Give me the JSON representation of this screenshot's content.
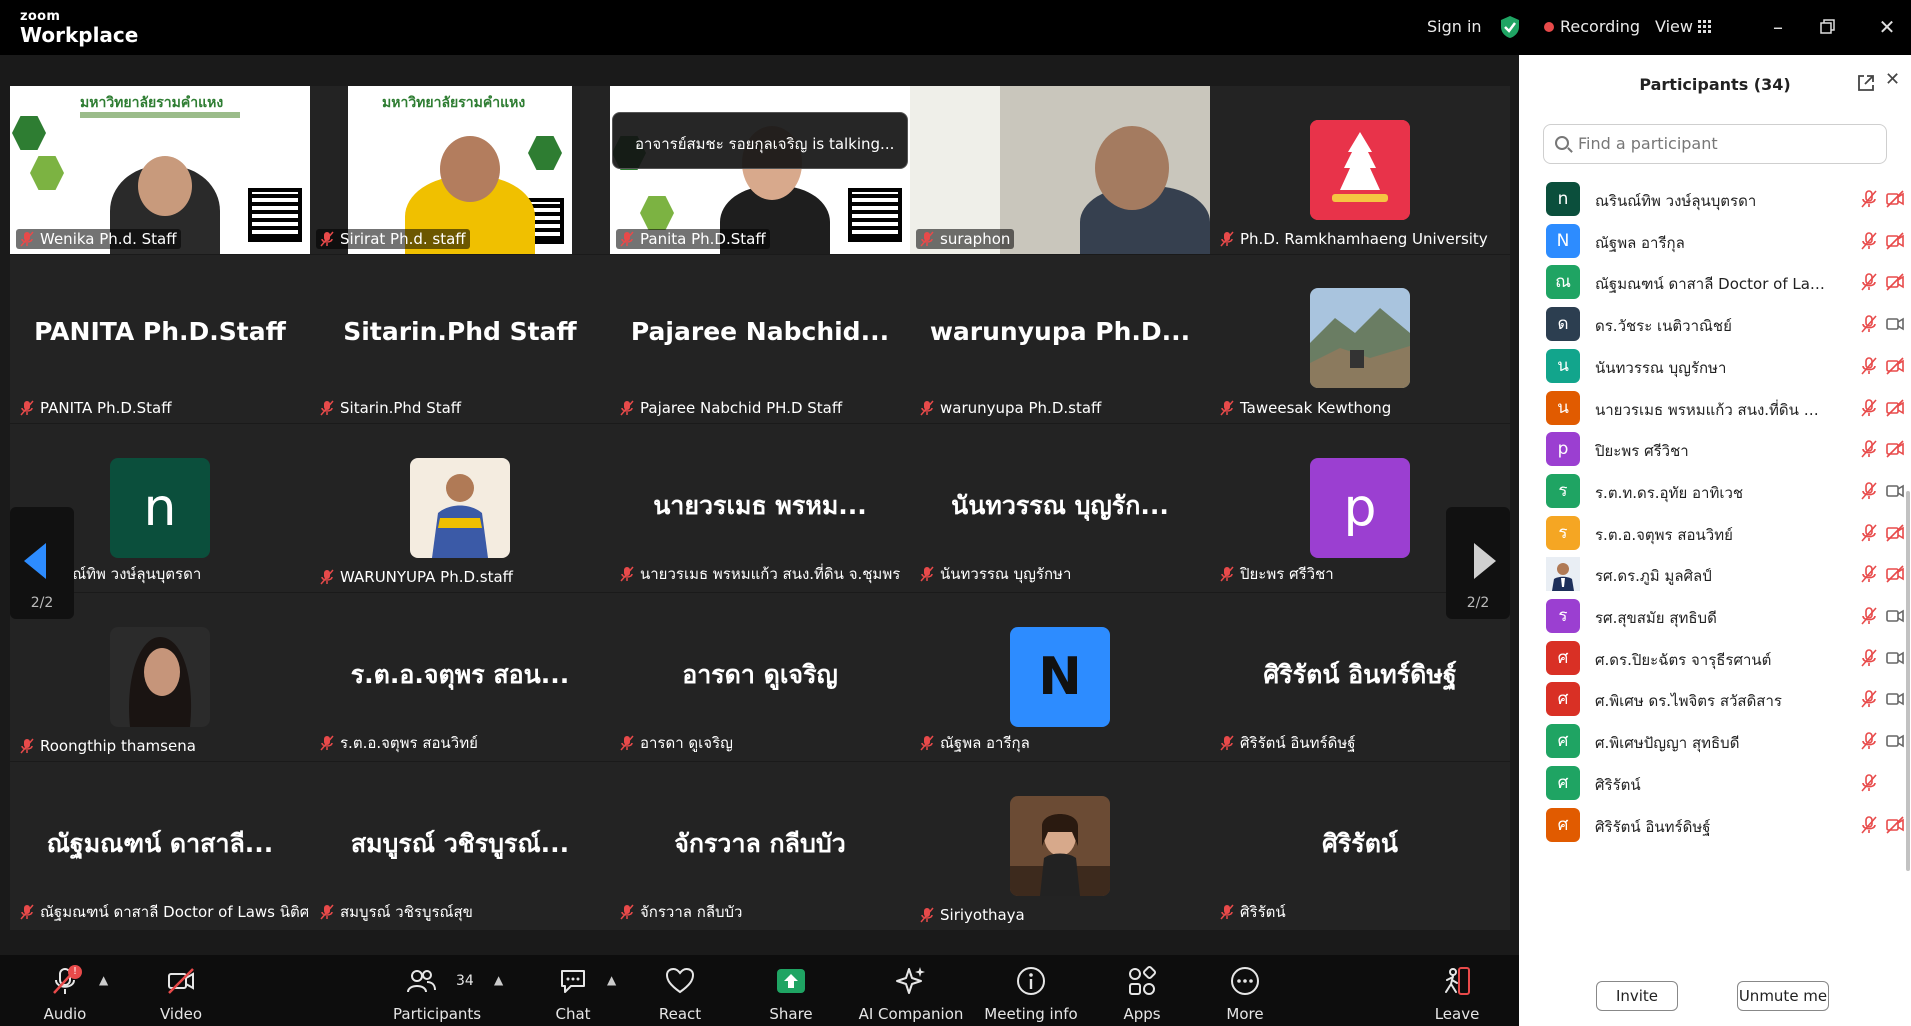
{
  "app": {
    "brand_small": "zoom",
    "brand_big": "Workplace"
  },
  "topbar": {
    "sign_in": "Sign in",
    "recording": "Recording",
    "view": "View"
  },
  "talking_banner": "อาจารย์สมชะ  รอยกุลเจริญ is talking...",
  "pager": {
    "left": "2/2",
    "right": "2/2"
  },
  "tiles": [
    {
      "name": "Wenika Ph.d. Staff",
      "big": ""
    },
    {
      "name": "Sirirat Ph.d. staff",
      "big": ""
    },
    {
      "name": "Panita Ph.D.Staff",
      "big": ""
    },
    {
      "name": "suraphon",
      "big": ""
    },
    {
      "name": "Ph.D. Ramkhamhaeng University",
      "big": ""
    },
    {
      "name": "PANITA Ph.D.Staff",
      "big": "PANITA Ph.D.Staff"
    },
    {
      "name": "Sitarin.Phd Staff",
      "big": "Sitarin.Phd Staff"
    },
    {
      "name": "Pajaree Nabchid PH.D Staff",
      "big": "Pajaree  Nabchid..."
    },
    {
      "name": "warunyupa Ph.D.staff",
      "big": "warunyupa  Ph.D..."
    },
    {
      "name": "Taweesak Kewthong",
      "big": ""
    },
    {
      "name": "ณรินณ์ทิพ วงษ์ลุนบุตรดา",
      "big": "",
      "avatar": "n"
    },
    {
      "name": "WARUNYUPA Ph.D.staff",
      "big": ""
    },
    {
      "name": "นายวรเมธ  พรหมแก้ว  สนง.ที่ดิน จ.ชุมพร",
      "big": "นายวรเมธ  พรหม..."
    },
    {
      "name": "นันทวรรณ บุญรักษา",
      "big": "นันทวรรณ บุญรัก..."
    },
    {
      "name": "ปิยะพร ศรีวิชา",
      "big": "",
      "avatar": "p"
    },
    {
      "name": "Roongthip thamsena",
      "big": ""
    },
    {
      "name": "ร.ต.อ.จตุพร  สอนวิทย์",
      "big": "ร.ต.อ.จตุพร  สอน..."
    },
    {
      "name": "อารดา ดูเจริญ",
      "big": "อารดา ดูเจริญ"
    },
    {
      "name": "ณัฐพล อารีกุล",
      "big": "",
      "avatar": "N"
    },
    {
      "name": "ศิริรัตน์ อินทร์ดิษฐ์",
      "big": "ศิริรัตน์ อินทร์ดิษฐ์"
    },
    {
      "name": "ณัฐมณฑน์ ดาสาลี Doctor of Laws นิติศา...",
      "big": "ณัฐมณฑน์ ดาสาลี..."
    },
    {
      "name": "สมบูรณ์ วชิรบูรณ์สุข",
      "big": "สมบูรณ์ วชิรบูรณ์..."
    },
    {
      "name": "จักรวาล กลีบบัว",
      "big": "จักรวาล กลีบบัว"
    },
    {
      "name": "Siriyothaya",
      "big": ""
    },
    {
      "name": "ศิริรัตน์",
      "big": "ศิริรัตน์"
    }
  ],
  "toolbar": {
    "audio": "Audio",
    "video": "Video",
    "participants": "Participants",
    "participants_count": "34",
    "chat": "Chat",
    "react": "React",
    "share": "Share",
    "ai_companion": "AI Companion",
    "meeting_info": "Meeting info",
    "apps": "Apps",
    "more": "More",
    "leave": "Leave",
    "audio_badge": "!"
  },
  "panel": {
    "title": "Participants (34)",
    "search_placeholder": "Find a participant",
    "invite": "Invite",
    "unmute_me": "Unmute me",
    "participants": [
      {
        "initial": "n",
        "color": "#0b4f3c",
        "name": "ณรินณ์ทิพ วงษ์ลุนบุตรดา",
        "video": "off"
      },
      {
        "initial": "N",
        "color": "#2d8cff",
        "name": "ณัฐพล อารีกุล",
        "video": "off"
      },
      {
        "initial": "ณ",
        "color": "#1fa463",
        "name": "ณัฐมณฑน์ ดาสาลี Doctor of Laws ...",
        "video": "off"
      },
      {
        "initial": "ด",
        "color": "#2c3e50",
        "name": "ดร.วัชระ เนติวาณิชย์",
        "video": "on"
      },
      {
        "initial": "น",
        "color": "#12a58c",
        "name": "นันทวรรณ บุญรักษา",
        "video": "off"
      },
      {
        "initial": "น",
        "color": "#e15b00",
        "name": "นายวรเมธ  พรหมแก้ว  สนง.ที่ดิน จ.ชุม...",
        "video": "off"
      },
      {
        "initial": "p",
        "color": "#9b3fd1",
        "name": "ปิยะพร ศรีวิชา",
        "video": "off"
      },
      {
        "initial": "ร",
        "color": "#1fa463",
        "name": "ร.ต.ท.ดร.อุทัย อาทิเวช",
        "video": "on"
      },
      {
        "initial": "ร",
        "color": "#f5a623",
        "name": "ร.ต.อ.จตุพร  สอนวิทย์",
        "video": "off"
      },
      {
        "initial": "",
        "color": "#dddddd",
        "name": "รศ.ดร.ภูมิ มูลศิลป์",
        "video": "off",
        "photo": true
      },
      {
        "initial": "ร",
        "color": "#9b3fd1",
        "name": "รศ.สุขสมัย  สุทธิบดี",
        "video": "on"
      },
      {
        "initial": "ศ",
        "color": "#d93025",
        "name": "ศ.ดร.ปิยะฉัตร จารุธีรศานต์",
        "video": "on"
      },
      {
        "initial": "ศ",
        "color": "#d93025",
        "name": "ศ.พิเศษ ดร.ไพจิตร  สวัสดิสาร",
        "video": "on"
      },
      {
        "initial": "ศ",
        "color": "#1fa463",
        "name": "ศ.พิเศษปัญญา สุทธิบดี",
        "video": "on"
      },
      {
        "initial": "ศ",
        "color": "#1fa463",
        "name": "ศิริรัตน์",
        "video": "none"
      },
      {
        "initial": "ศ",
        "color": "#e15b00",
        "name": "ศิริรัตน์ อินทร์ดิษฐ์",
        "video": "off"
      }
    ]
  },
  "colors": {
    "accent": "#2d8cff",
    "recording": "#e84a4a",
    "muted": "#e84a4a",
    "share": "#1fa463"
  }
}
